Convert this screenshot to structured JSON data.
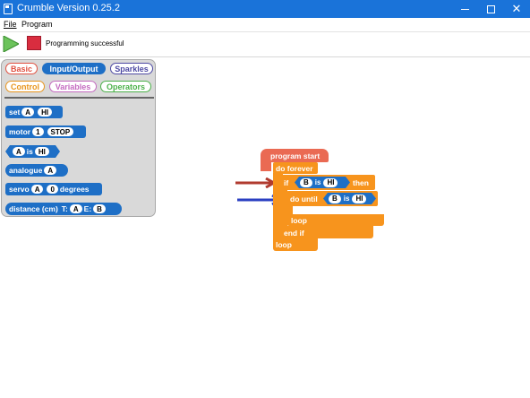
{
  "window": {
    "title": "Crumble Version 0.25.2",
    "controls": {
      "minimize": "—",
      "maximize": "☐",
      "close": "✕"
    }
  },
  "menu": {
    "file": "File",
    "program": "Program"
  },
  "toolbar": {
    "status": "Programming successful"
  },
  "palette": {
    "categories": {
      "basic": "Basic",
      "input_output": "Input/Output",
      "sparkles": "Sparkles",
      "control": "Control",
      "variables": "Variables",
      "operators": "Operators"
    },
    "blocks": {
      "set": {
        "label": "set",
        "pin": "A",
        "value": "HI"
      },
      "motor": {
        "label": "motor",
        "num": "1",
        "value": "STOP"
      },
      "is": {
        "pin": "A",
        "label": "is",
        "value": "HI"
      },
      "analogue": {
        "label": "analogue",
        "pin": "A"
      },
      "servo": {
        "label": "servo",
        "pin": "A",
        "value": "0",
        "unit": "degrees"
      },
      "distance": {
        "label": "distance (cm)",
        "t_label": "T:",
        "t_pin": "A",
        "e_label": "E:",
        "e_pin": "B"
      }
    }
  },
  "script": {
    "program_start": "program start",
    "do_forever": "do forever",
    "if_label": "if",
    "if_pin": "B",
    "if_is": "is",
    "if_value": "HI",
    "then_label": "then",
    "do_until": "do until",
    "until_pin": "B",
    "until_is": "is",
    "until_value": "HI",
    "loop_inner": "loop",
    "end_if": "end if",
    "loop_outer": "loop"
  },
  "colors": {
    "titlebar": "#1a73d9",
    "io_block": "#1e6fc6",
    "control_block": "#f7941d",
    "start_block": "#ea6a53",
    "arrow_red": "#b03a2e",
    "arrow_blue": "#2b3fc2"
  },
  "icons": {
    "app": "crumble-app-icon",
    "run": "play-icon",
    "stop": "stop-icon",
    "arrows": [
      "red-arrow-icon",
      "blue-arrow-icon"
    ]
  }
}
